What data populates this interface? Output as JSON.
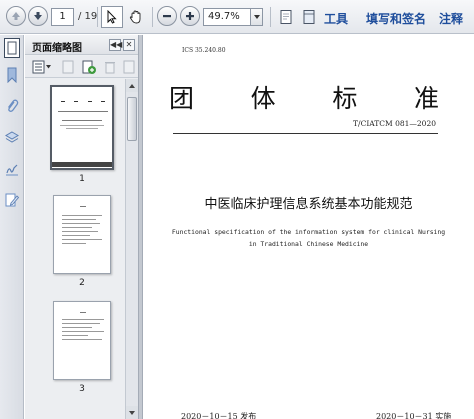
{
  "toolbar": {
    "current_page": "1",
    "total_pages": "/ 19",
    "zoom": "49.7%",
    "tools_label": "工具",
    "fill_sign_label": "填写和签名",
    "comment_label": "注释"
  },
  "thumbnail_panel": {
    "title": "页面缩略图",
    "pages": [
      {
        "number": "1"
      },
      {
        "number": "2"
      },
      {
        "number": "3"
      }
    ]
  },
  "document": {
    "ics": "ICS 35.240.80",
    "standard_mark": [
      "团",
      "体",
      "标",
      "准"
    ],
    "code": "T/CIATCM 081—2020",
    "title_cn": "中医临床护理信息系统基本功能规范",
    "title_en_line1": "Functional specification of the information system for clinical Nursing",
    "title_en_line2": "in Traditional Chinese Medicine",
    "publish_date": "2020－10－15 发布",
    "implement_date": "2020－10－31 实施"
  },
  "colors": {
    "toolbar_link": "#1f4e9c",
    "rail_icon": "#6b8fc4"
  }
}
